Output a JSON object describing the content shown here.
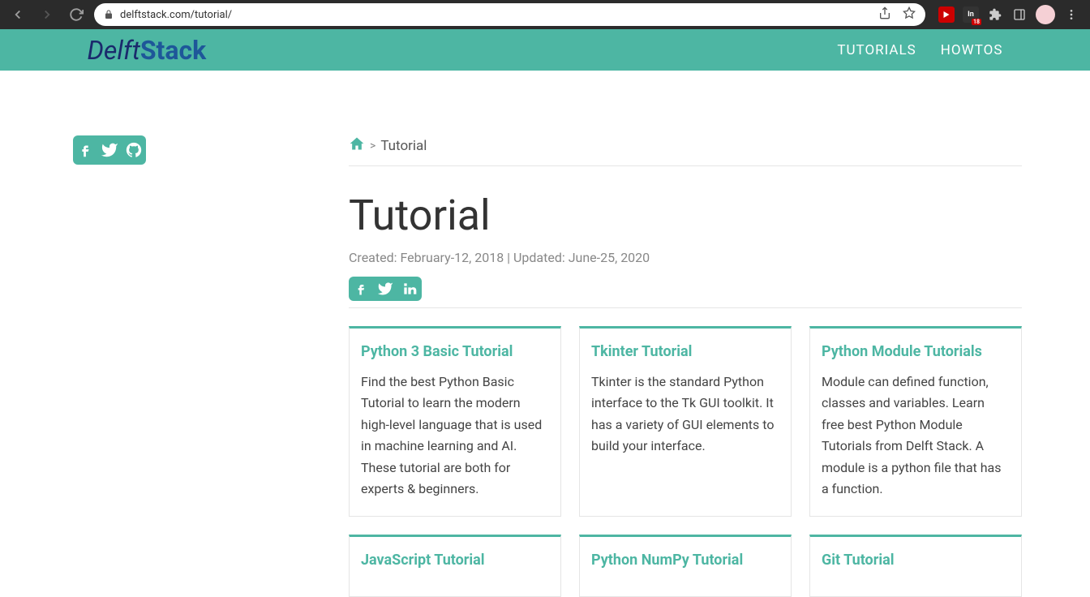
{
  "browser": {
    "url": "delftstack.com/tutorial/",
    "badge": "18"
  },
  "header": {
    "logo_part1": "Delft",
    "logo_part2": "Stack",
    "nav": [
      "TUTORIALS",
      "HOWTOS"
    ]
  },
  "breadcrumb": {
    "sep": ">",
    "current": "Tutorial"
  },
  "page": {
    "title": "Tutorial",
    "dateline": "Created: February-12, 2018 | Updated: June-25, 2020"
  },
  "cards": [
    {
      "title": "Python 3 Basic Tutorial",
      "desc": "Find the best Python Basic Tutorial to learn the modern high-level language that is used in machine learning and AI. These tutorial are both for experts & beginners."
    },
    {
      "title": "Tkinter Tutorial",
      "desc": "Tkinter is the standard Python interface to the Tk GUI toolkit. It has a variety of GUI elements to build your interface."
    },
    {
      "title": "Python Module Tutorials",
      "desc": "Module can defined function, classes and variables. Learn free best Python Module Tutorials from Delft Stack. A module is a python file that has a function."
    },
    {
      "title": "JavaScript Tutorial",
      "desc": ""
    },
    {
      "title": "Python NumPy Tutorial",
      "desc": ""
    },
    {
      "title": "Git Tutorial",
      "desc": ""
    }
  ]
}
